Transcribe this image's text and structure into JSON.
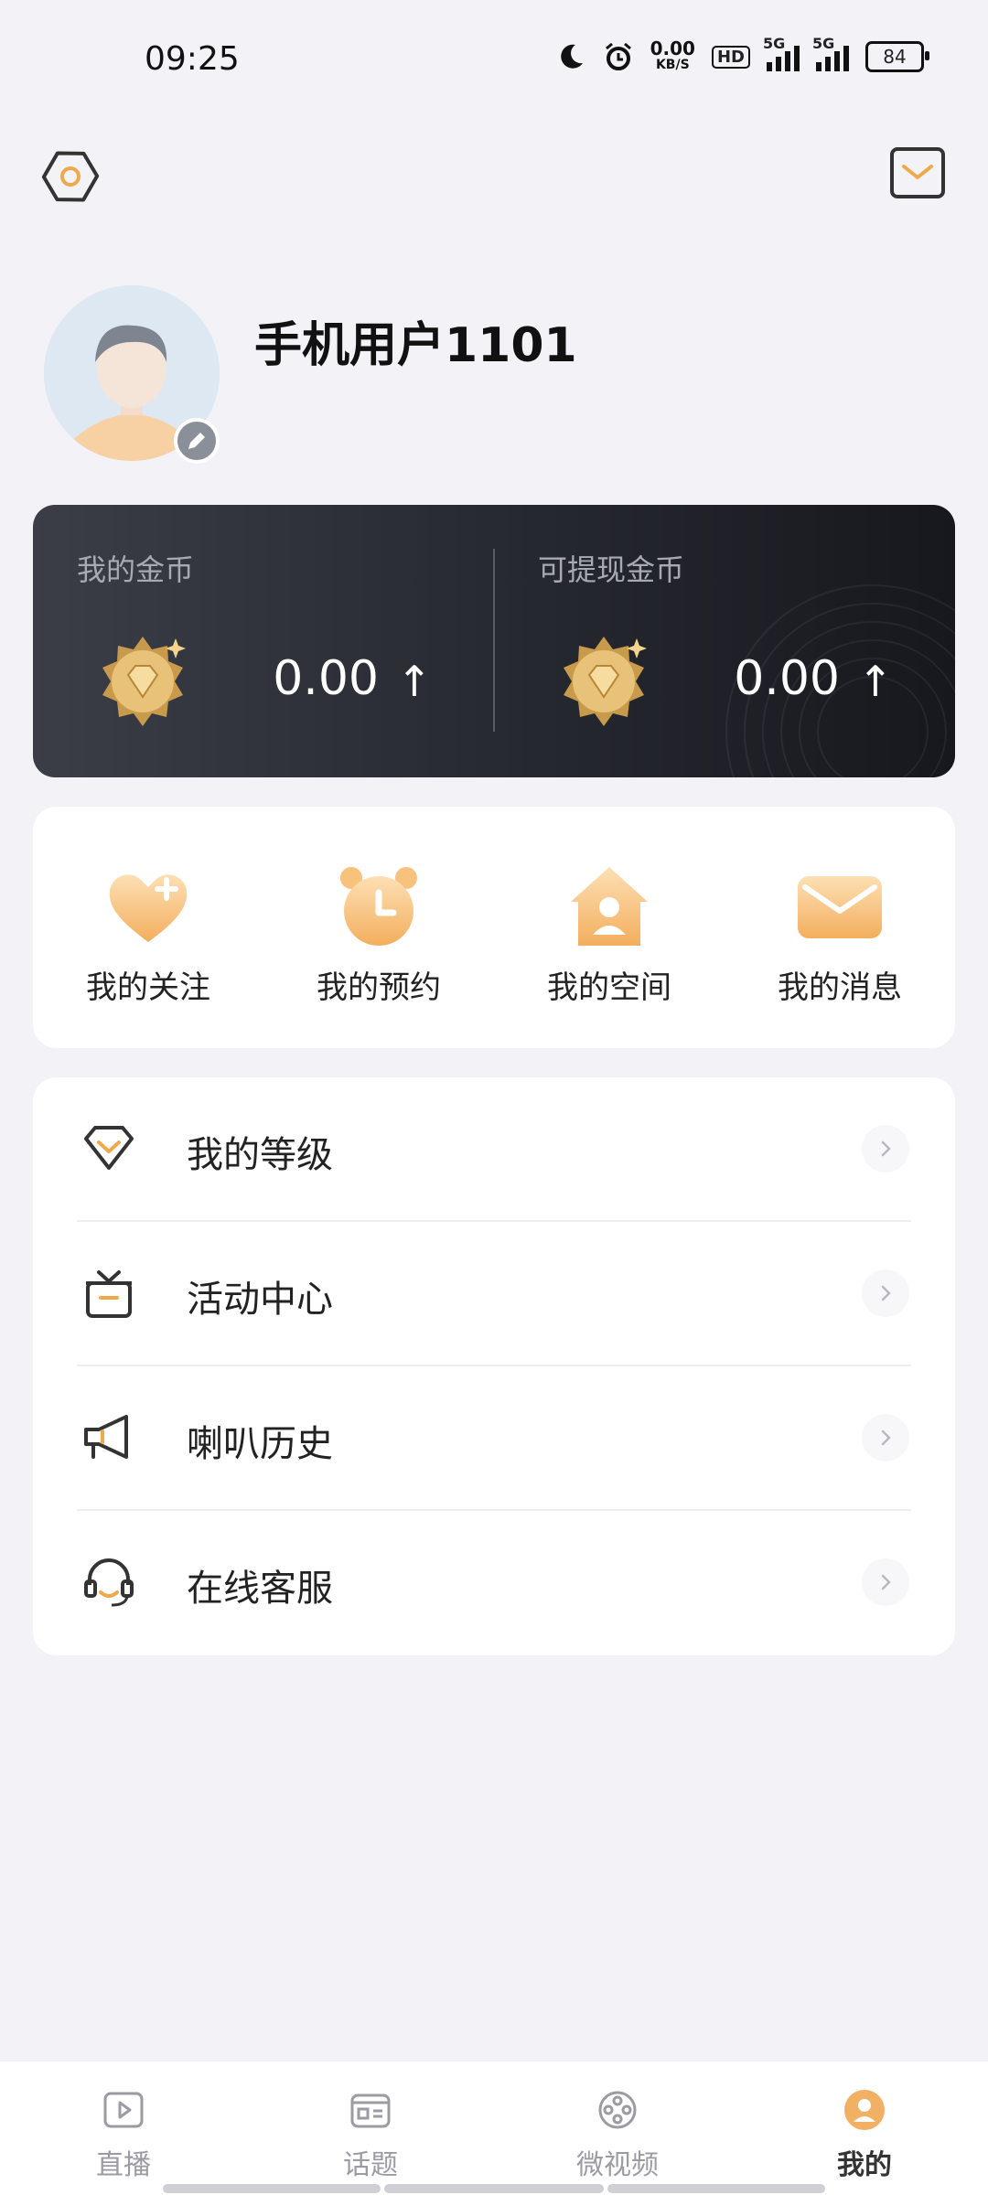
{
  "status_bar": {
    "time": "09:25",
    "speed_value": "0.00",
    "speed_unit": "KB/S",
    "hd_label": "HD",
    "signal_1_label": "5G",
    "signal_2_label": "5G",
    "battery": "84",
    "icons": [
      "moon-icon",
      "alarm-icon"
    ]
  },
  "header": {
    "left_icon": "settings-hexagon-icon",
    "right_icon": "message-box-icon"
  },
  "profile": {
    "username": "手机用户1101"
  },
  "coins": {
    "my_coins_label": "我的金币",
    "my_coins_value": "0.00",
    "withdrawable_label": "可提现金币",
    "withdrawable_value": "0.00",
    "arrow": "↑"
  },
  "quick_actions": [
    {
      "label": "我的关注",
      "icon": "heart-plus-icon"
    },
    {
      "label": "我的预约",
      "icon": "alarm-clock-icon"
    },
    {
      "label": "我的空间",
      "icon": "home-user-icon"
    },
    {
      "label": "我的消息",
      "icon": "envelope-icon"
    }
  ],
  "menu": [
    {
      "label": "我的等级",
      "icon": "diamond-icon"
    },
    {
      "label": "活动中心",
      "icon": "gift-icon"
    },
    {
      "label": "喇叭历史",
      "icon": "megaphone-icon"
    },
    {
      "label": "在线客服",
      "icon": "headset-icon"
    }
  ],
  "bottom_nav": [
    {
      "label": "直播",
      "icon": "play-icon",
      "active": false
    },
    {
      "label": "话题",
      "icon": "topic-icon",
      "active": false
    },
    {
      "label": "微视频",
      "icon": "film-reel-icon",
      "active": false
    },
    {
      "label": "我的",
      "icon": "user-icon",
      "active": true
    }
  ],
  "colors": {
    "accent": "#f0b25c",
    "card_dark": "#262830",
    "background": "#f2f2f7"
  }
}
